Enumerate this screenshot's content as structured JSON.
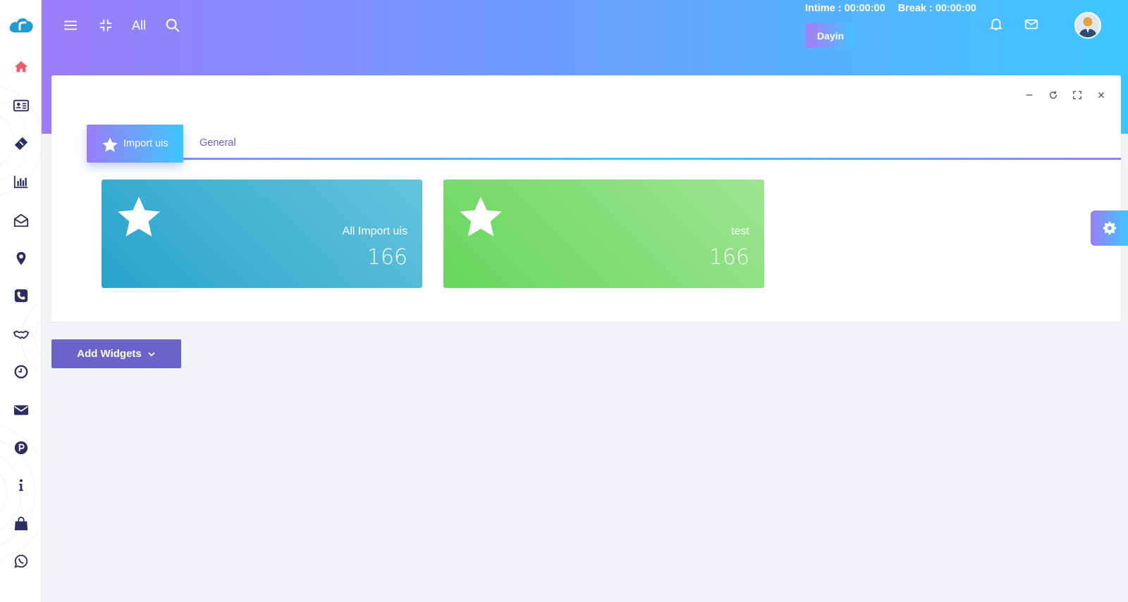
{
  "header": {
    "all_label": "All",
    "intime": "Intime : 00:00:00",
    "break": "Break : 00:00:00",
    "user_chip": "Dayin"
  },
  "sidebar": {
    "items": [
      {
        "name": "home-icon",
        "color": "#f05b6b"
      },
      {
        "name": "id-card-icon",
        "color": "#2b2d63"
      },
      {
        "name": "ticket-icon",
        "color": "#2b2d63"
      },
      {
        "name": "bar-chart-icon",
        "color": "#2b2d63"
      },
      {
        "name": "envelope-open-icon",
        "color": "#2b2d63"
      },
      {
        "name": "map-pin-icon",
        "color": "#2b2d63"
      },
      {
        "name": "phone-icon",
        "color": "#2b2d63"
      },
      {
        "name": "handshake-icon",
        "color": "#2b2d63"
      },
      {
        "name": "clock-icon",
        "color": "#2b2d63"
      },
      {
        "name": "mail-icon",
        "color": "#2b2d63"
      },
      {
        "name": "parking-icon",
        "color": "#2b2d63"
      },
      {
        "name": "info-icon",
        "color": "#2b2d63"
      },
      {
        "name": "shopping-bag-icon",
        "color": "#2b2d63"
      },
      {
        "name": "whatsapp-icon",
        "color": "#2b2d63"
      }
    ]
  },
  "card": {
    "tabs": [
      {
        "label": "Import uis",
        "active": true
      },
      {
        "label": "General",
        "active": false
      }
    ],
    "stats": [
      {
        "label": "All Import uis",
        "value": "166",
        "color": "#27a3cd"
      },
      {
        "label": "test",
        "value": "166",
        "color": "#67d65c"
      }
    ]
  },
  "actions": {
    "add_widgets": "Add Widgets"
  },
  "colors": {
    "header_gradient_start": "#9b7cf9",
    "header_gradient_end": "#3ec7ff",
    "primary_button": "#6c63c9"
  }
}
